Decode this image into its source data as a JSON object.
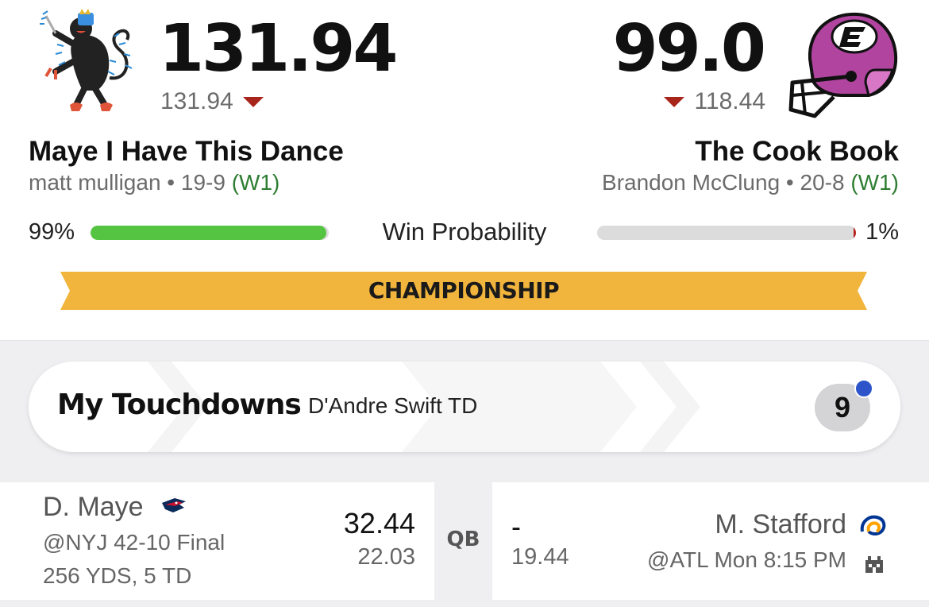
{
  "matchup": {
    "left": {
      "score": "131.94",
      "projected": "131.94",
      "team_name": "Maye I Have This Dance",
      "owner": "matt mulligan",
      "record": "19-9",
      "streak": "(W1)",
      "win_pct": "99%",
      "win_fraction": 0.99
    },
    "right": {
      "score": "99.0",
      "projected": "118.44",
      "team_name": "The Cook Book",
      "owner": "Brandon McClung",
      "record": "20-8",
      "streak": "(W1)",
      "win_pct": "1%",
      "win_fraction": 0.01
    },
    "win_prob_label": "Win Probability",
    "round_label": "CHAMPIONSHIP",
    "separator": "•"
  },
  "touchdowns": {
    "title": "My Touchdowns",
    "latest": "D'Andre Swift TD",
    "count": "9"
  },
  "players": [
    {
      "slot": "QB",
      "left": {
        "name": "D. Maye",
        "team_icon": "patriots-logo-icon",
        "game": "@NYJ  42-10  Final",
        "stats": "256 YDS, 5 TD",
        "points": "32.44",
        "projected": "22.03"
      },
      "right": {
        "name": "M. Stafford",
        "team_icon": "rams-logo-icon",
        "game": "@ATL  Mon  8:15 PM",
        "points": "-",
        "projected": "19.44"
      }
    }
  ],
  "colors": {
    "win_bar": "#55c442",
    "loss_bar": "#b8221a",
    "ribbon": "#f1b43c",
    "streak_win": "#2e7d32",
    "score_down_arrow": "#a8251b",
    "notification_dot": "#2d55c9",
    "helmet": "#b0449f"
  }
}
